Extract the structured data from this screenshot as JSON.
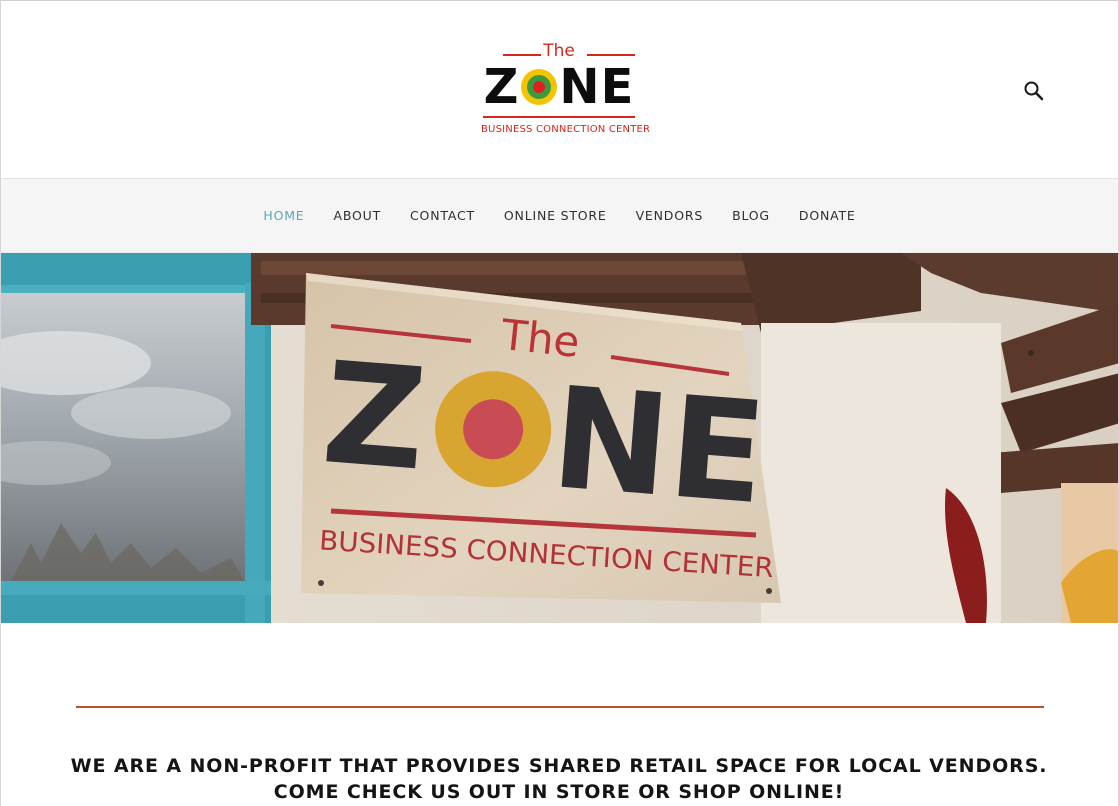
{
  "logo": {
    "the": "The",
    "zone_pre": "Z",
    "zone_post": "NE",
    "subtitle": "BUSINESS CONNECTION CENTER",
    "colors": {
      "red": "#d8251f",
      "yellow": "#f5c400",
      "green": "#3b9a3e",
      "black": "#0d0d0d"
    }
  },
  "header": {
    "search_icon": "search-icon"
  },
  "nav": {
    "items": [
      {
        "label": "HOME",
        "active": true
      },
      {
        "label": "ABOUT"
      },
      {
        "label": "CONTACT"
      },
      {
        "label": "ONLINE STORE"
      },
      {
        "label": "VENDORS"
      },
      {
        "label": "BLOG"
      },
      {
        "label": "DONATE"
      }
    ],
    "active_color": "#5aa8b8"
  },
  "hero": {
    "sign_the": "The",
    "sign_zone_pre": "Z",
    "sign_zone_post": "NE",
    "sign_subtitle": "BUSINESS CONNECTION CENTER"
  },
  "content": {
    "tagline_line1": "WE ARE A NON-PROFIT THAT PROVIDES SHARED RETAIL SPACE FOR LOCAL VENDORS.",
    "tagline_line2": "COME CHECK US OUT IN STORE OR SHOP ONLINE!",
    "rule_color": "#b5532e"
  }
}
